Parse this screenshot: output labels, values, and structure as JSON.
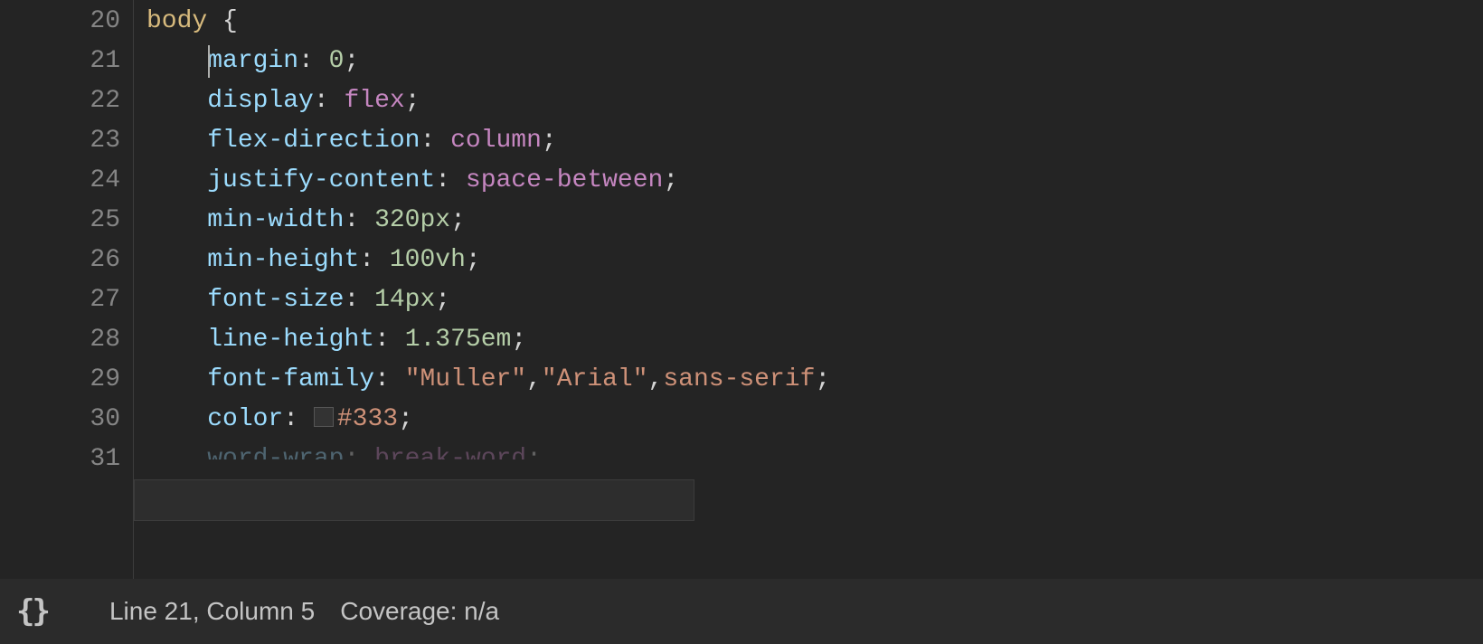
{
  "editor": {
    "lines": [
      {
        "num": 20,
        "indent": 0,
        "tokens": [
          {
            "t": "body",
            "c": "tok-sel"
          },
          {
            "t": " ",
            "c": "tok-plain"
          },
          {
            "t": "{",
            "c": "tok-brace"
          }
        ]
      },
      {
        "num": 21,
        "indent": 4,
        "cursorCol": 0,
        "tokens": [
          {
            "t": "margin",
            "c": "tok-prop"
          },
          {
            "t": ":",
            "c": "tok-punc"
          },
          {
            "t": " ",
            "c": "tok-plain"
          },
          {
            "t": "0",
            "c": "tok-num"
          },
          {
            "t": ";",
            "c": "tok-punc"
          }
        ]
      },
      {
        "num": 22,
        "indent": 4,
        "tokens": [
          {
            "t": "display",
            "c": "tok-prop"
          },
          {
            "t": ":",
            "c": "tok-punc"
          },
          {
            "t": " ",
            "c": "tok-plain"
          },
          {
            "t": "flex",
            "c": "tok-kw"
          },
          {
            "t": ";",
            "c": "tok-punc"
          }
        ]
      },
      {
        "num": 23,
        "indent": 4,
        "tokens": [
          {
            "t": "flex-direction",
            "c": "tok-prop"
          },
          {
            "t": ":",
            "c": "tok-punc"
          },
          {
            "t": " ",
            "c": "tok-plain"
          },
          {
            "t": "column",
            "c": "tok-kw"
          },
          {
            "t": ";",
            "c": "tok-punc"
          }
        ]
      },
      {
        "num": 24,
        "indent": 4,
        "tokens": [
          {
            "t": "justify-content",
            "c": "tok-prop"
          },
          {
            "t": ":",
            "c": "tok-punc"
          },
          {
            "t": " ",
            "c": "tok-plain"
          },
          {
            "t": "space-between",
            "c": "tok-kw"
          },
          {
            "t": ";",
            "c": "tok-punc"
          }
        ]
      },
      {
        "num": 25,
        "indent": 4,
        "tokens": [
          {
            "t": "min-width",
            "c": "tok-prop"
          },
          {
            "t": ":",
            "c": "tok-punc"
          },
          {
            "t": " ",
            "c": "tok-plain"
          },
          {
            "t": "320px",
            "c": "tok-num"
          },
          {
            "t": ";",
            "c": "tok-punc"
          }
        ]
      },
      {
        "num": 26,
        "indent": 4,
        "tokens": [
          {
            "t": "min-height",
            "c": "tok-prop"
          },
          {
            "t": ":",
            "c": "tok-punc"
          },
          {
            "t": " ",
            "c": "tok-plain"
          },
          {
            "t": "100vh",
            "c": "tok-num"
          },
          {
            "t": ";",
            "c": "tok-punc"
          }
        ]
      },
      {
        "num": 27,
        "indent": 4,
        "tokens": [
          {
            "t": "font-size",
            "c": "tok-prop"
          },
          {
            "t": ":",
            "c": "tok-punc"
          },
          {
            "t": " ",
            "c": "tok-plain"
          },
          {
            "t": "14px",
            "c": "tok-num"
          },
          {
            "t": ";",
            "c": "tok-punc"
          }
        ]
      },
      {
        "num": 28,
        "indent": 4,
        "tokens": [
          {
            "t": "line-height",
            "c": "tok-prop"
          },
          {
            "t": ":",
            "c": "tok-punc"
          },
          {
            "t": " ",
            "c": "tok-plain"
          },
          {
            "t": "1.375em",
            "c": "tok-num"
          },
          {
            "t": ";",
            "c": "tok-punc"
          }
        ]
      },
      {
        "num": 29,
        "indent": 4,
        "tokens": [
          {
            "t": "font-family",
            "c": "tok-prop"
          },
          {
            "t": ":",
            "c": "tok-punc"
          },
          {
            "t": " ",
            "c": "tok-plain"
          },
          {
            "t": "\"Muller\"",
            "c": "tok-str"
          },
          {
            "t": ",",
            "c": "tok-punc"
          },
          {
            "t": "\"Arial\"",
            "c": "tok-str"
          },
          {
            "t": ",",
            "c": "tok-punc"
          },
          {
            "t": "sans-serif",
            "c": "tok-val"
          },
          {
            "t": ";",
            "c": "tok-punc"
          }
        ]
      },
      {
        "num": 30,
        "indent": 4,
        "tokens": [
          {
            "t": "color",
            "c": "tok-prop"
          },
          {
            "t": ":",
            "c": "tok-punc"
          },
          {
            "t": " ",
            "c": "tok-plain"
          },
          {
            "swatch": "#333333"
          },
          {
            "t": "#333",
            "c": "tok-val"
          },
          {
            "t": ";",
            "c": "tok-punc"
          }
        ]
      },
      {
        "num": 31,
        "indent": 4,
        "cutoff": true,
        "tokens": [
          {
            "t": "word-wrap",
            "c": "tok-prop"
          },
          {
            "t": ":",
            "c": "tok-punc"
          },
          {
            "t": " ",
            "c": "tok-plain"
          },
          {
            "t": "break-word",
            "c": "tok-kw"
          },
          {
            "t": ";",
            "c": "tok-punc"
          }
        ]
      }
    ]
  },
  "status": {
    "braces_icon": "{}",
    "position": "Line 21, Column 5",
    "coverage": "Coverage: n/a"
  },
  "colors": {
    "background": "#242424",
    "gutter_text": "#858585",
    "selector": "#d7ba7d",
    "property": "#9cdcfe",
    "string": "#ce9178",
    "number": "#b5cea8",
    "keyword": "#c586c0",
    "default": "#d4d4d4"
  }
}
